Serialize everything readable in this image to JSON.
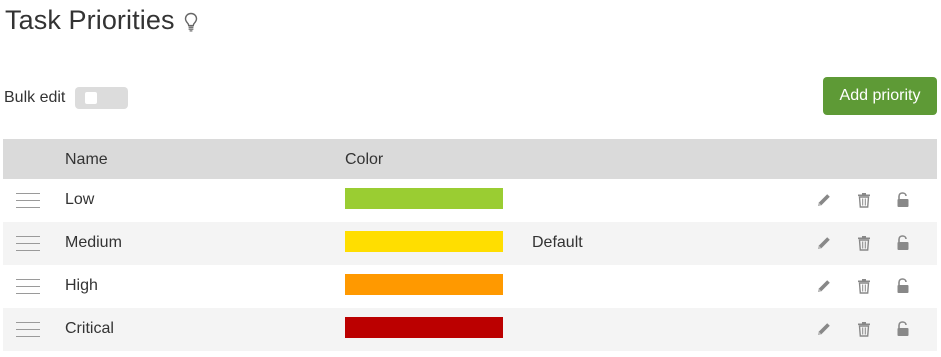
{
  "page": {
    "title": "Task Priorities",
    "title_icon": "lightbulb-icon"
  },
  "bulk_edit": {
    "label": "Bulk edit",
    "enabled": false
  },
  "add_button": {
    "label": "Add priority",
    "color": "#5e9a36"
  },
  "table": {
    "columns": [
      "Name",
      "Color"
    ],
    "rows": [
      {
        "name": "Low",
        "color": "#9acd32",
        "default_label": ""
      },
      {
        "name": "Medium",
        "color": "#ffde00",
        "default_label": "Default"
      },
      {
        "name": "High",
        "color": "#ff9900",
        "default_label": ""
      },
      {
        "name": "Critical",
        "color": "#bb0000",
        "default_label": ""
      }
    ],
    "row_actions": [
      "pencil-icon",
      "trash-icon",
      "unlock-icon"
    ]
  }
}
